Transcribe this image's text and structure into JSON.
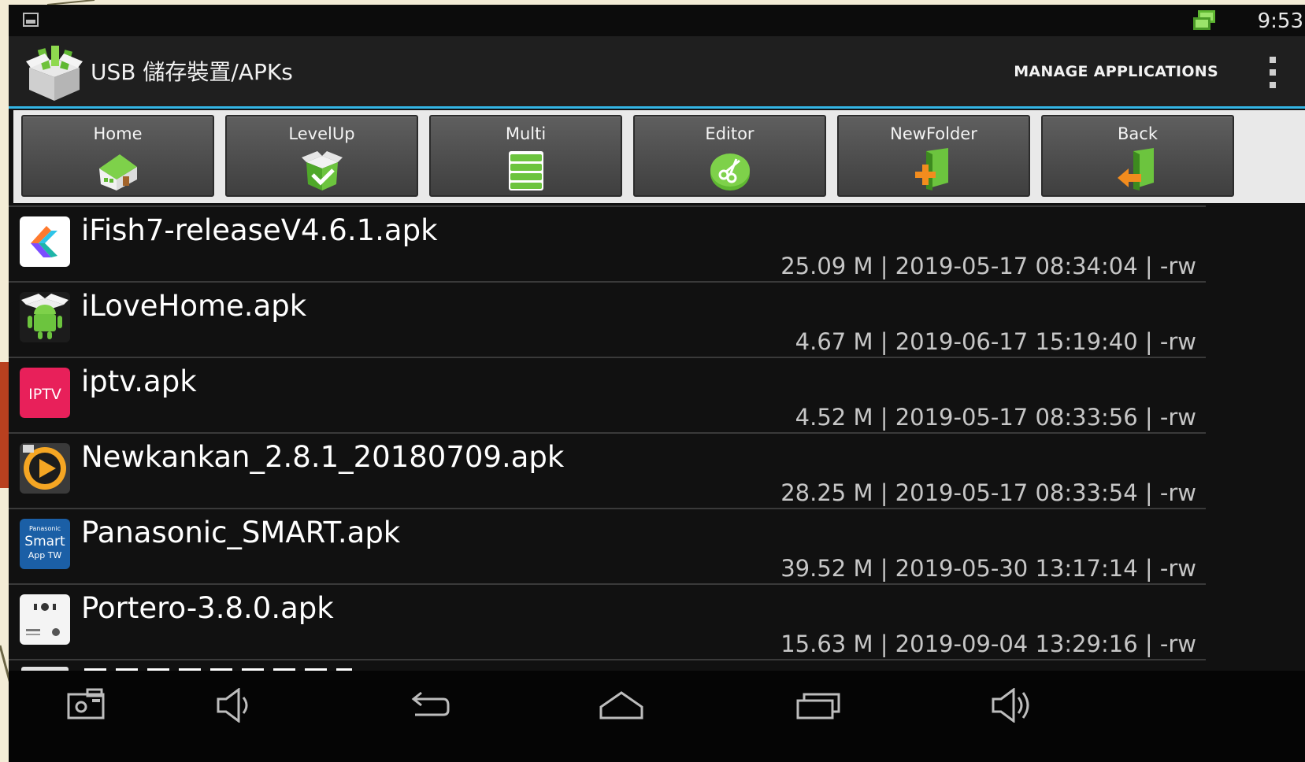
{
  "status_bar": {
    "time": "9:53"
  },
  "action_bar": {
    "title": "USB 儲存裝置/APKs",
    "manage_label": "MANAGE APPLICATIONS"
  },
  "toolbar": {
    "buttons": [
      {
        "label": "Home",
        "icon": "house-icon"
      },
      {
        "label": "LevelUp",
        "icon": "level-up-box-icon"
      },
      {
        "label": "Multi",
        "icon": "multi-select-icon"
      },
      {
        "label": "Editor",
        "icon": "scissors-icon"
      },
      {
        "label": "NewFolder",
        "icon": "new-folder-icon"
      },
      {
        "label": "Back",
        "icon": "back-arrow-icon"
      }
    ]
  },
  "files": [
    {
      "name": "iFish7-releaseV4.6.1.apk",
      "meta": "25.09 M | 2019-05-17 08:34:04 | -rw",
      "icon": "ifish-app-icon"
    },
    {
      "name": "iLoveHome.apk",
      "meta": "4.67 M | 2019-06-17 15:19:40 | -rw",
      "icon": "android-package-icon"
    },
    {
      "name": "iptv.apk",
      "meta": "4.52 M | 2019-05-17 08:33:56 | -rw",
      "icon": "iptv-app-icon",
      "icon_text": "IPTV"
    },
    {
      "name": "Newkankan_2.8.1_20180709.apk",
      "meta": "28.25 M | 2019-05-17 08:33:54 | -rw",
      "icon": "newkankan-play-icon"
    },
    {
      "name": "Panasonic_SMART.apk",
      "meta": "39.52 M | 2019-05-30 13:17:14 | -rw",
      "icon": "panasonic-smart-app-icon",
      "icon_text_1": "Panasonic",
      "icon_text_2": "Smart",
      "icon_text_3": "App TW"
    },
    {
      "name": "Portero-3.8.0.apk",
      "meta": "15.63 M | 2019-09-04 13:29:16 | -rw",
      "icon": "portero-app-icon"
    }
  ],
  "colors": {
    "accent": "#33b5e5",
    "iptv_bg": "#e8205a",
    "panasonic_bg": "#1b5fa6",
    "green": "#5fb832"
  }
}
